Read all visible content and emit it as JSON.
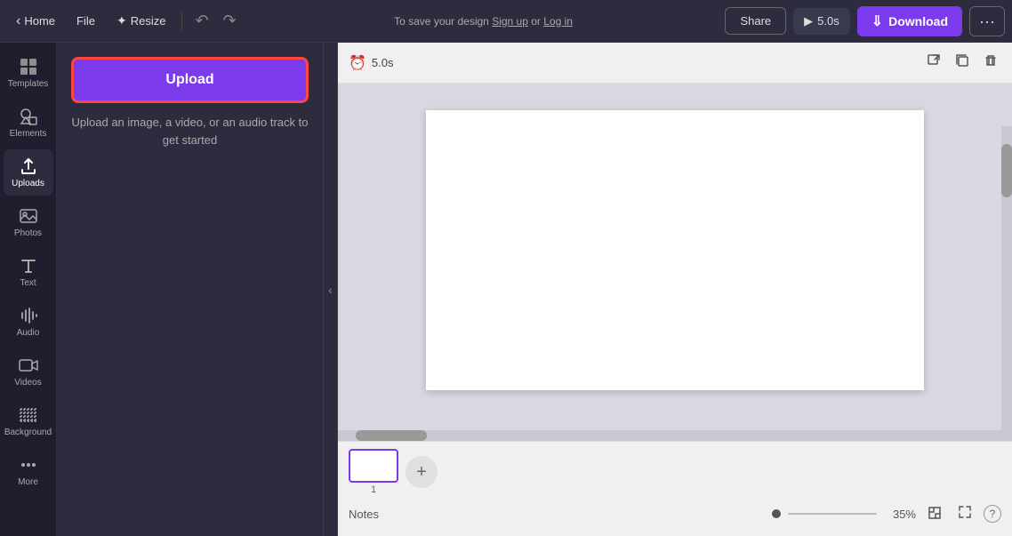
{
  "header": {
    "home_label": "Home",
    "file_label": "File",
    "resize_label": "Resize",
    "save_text": "To save your design ",
    "signup_text": "Sign up",
    "or_text": " or ",
    "login_text": "Log in",
    "share_label": "Share",
    "preview_duration": "5.0s",
    "download_label": "Download",
    "more_icon": "•••"
  },
  "sidebar": {
    "items": [
      {
        "id": "templates",
        "label": "Templates",
        "icon": "grid"
      },
      {
        "id": "elements",
        "label": "Elements",
        "icon": "elements"
      },
      {
        "id": "uploads",
        "label": "Uploads",
        "icon": "upload"
      },
      {
        "id": "photos",
        "label": "Photos",
        "icon": "photo"
      },
      {
        "id": "text",
        "label": "Text",
        "icon": "text"
      },
      {
        "id": "audio",
        "label": "Audio",
        "icon": "audio"
      },
      {
        "id": "videos",
        "label": "Videos",
        "icon": "video"
      },
      {
        "id": "background",
        "label": "Background",
        "icon": "background"
      },
      {
        "id": "more",
        "label": "More",
        "icon": "more"
      }
    ]
  },
  "left_panel": {
    "upload_label": "Upload",
    "hint": "Upload an image, a video, or an audio track to get started"
  },
  "canvas": {
    "duration": "5.0s",
    "page_number": "1",
    "notes_label": "Notes",
    "zoom_percent": "35%",
    "collapse_icon": "‹"
  }
}
